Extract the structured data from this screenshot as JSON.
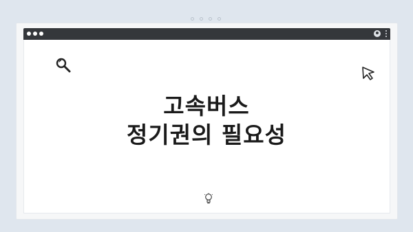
{
  "window": {
    "title_lines": [
      "고속버스",
      "정기권의 필요성"
    ]
  },
  "icons": {
    "search": "search-icon",
    "cursor": "cursor-icon",
    "bulb": "lightbulb-icon",
    "user": "user-icon",
    "menu": "kebab-menu-icon"
  },
  "colors": {
    "background": "#dfe6ee",
    "titlebar": "#34373b",
    "page": "#ffffff"
  }
}
